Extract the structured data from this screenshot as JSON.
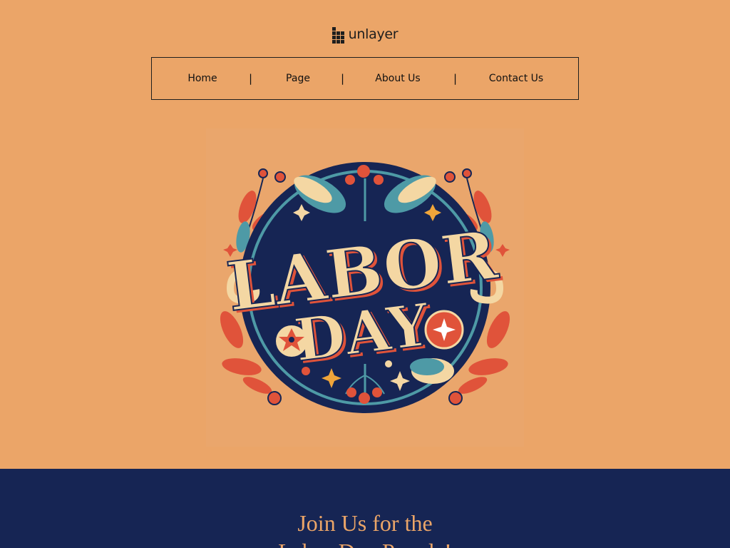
{
  "header": {
    "logo_text": "unlayer"
  },
  "nav": {
    "items": [
      {
        "label": "Home"
      },
      {
        "label": "Page"
      },
      {
        "label": "About Us"
      },
      {
        "label": "Contact Us"
      }
    ],
    "separator": "|"
  },
  "hero": {
    "badge_line1": "LABOR",
    "badge_line2": "DAY"
  },
  "section": {
    "heading_line1": "Join Us for  the",
    "heading_line2": "Labor Day Parade!"
  },
  "colors": {
    "background": "#eba568",
    "navy": "#162554",
    "red": "#e0533a",
    "teal": "#4e9aa6",
    "cream": "#f4d7a3"
  }
}
